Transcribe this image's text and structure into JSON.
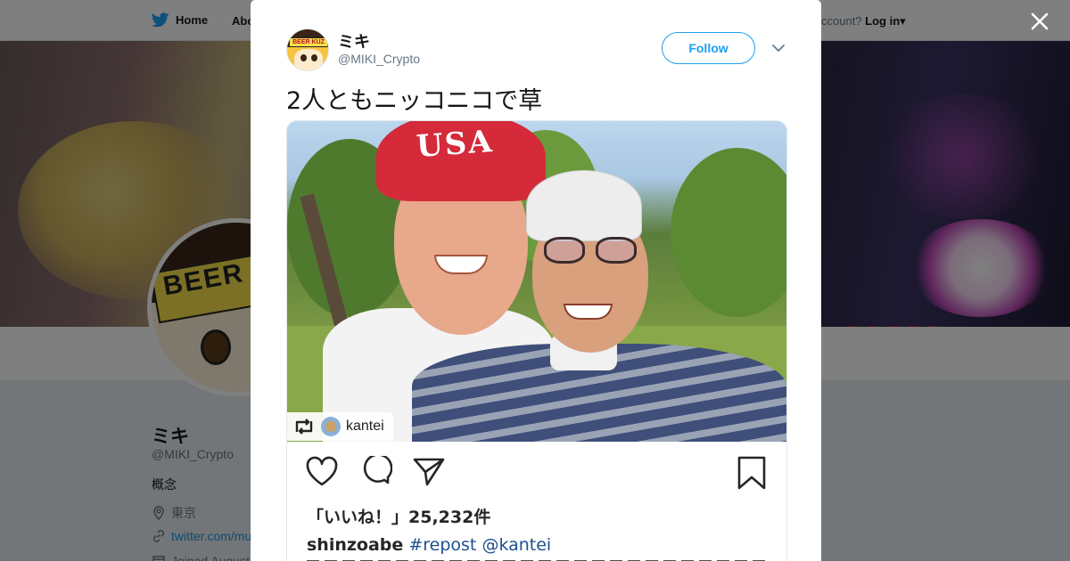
{
  "nav": {
    "home_label": "Home",
    "about_label": "Abo",
    "account_prompt": "ccount?",
    "login_label": "Log in"
  },
  "profile": {
    "name": "ミキ",
    "handle": "@MIKI_Crypto",
    "bio": "概念",
    "location": "東京",
    "url": "twitter.com/mu",
    "joined": "Joined August",
    "avatar_text": "BEER"
  },
  "tweet": {
    "author_name": "ミキ",
    "author_handle": "@MIKI_Crypto",
    "avatar_text": "BEER KUZ",
    "follow_label": "Follow",
    "text": "2人ともニッコニコで草",
    "media": {
      "cap_text": "USA",
      "repost_account": "kantei",
      "likes_text": "「いいね！」25,232件",
      "caption_user": "shinzoabe",
      "caption_hashtag": "#repost",
      "caption_mention": "@kantei"
    }
  },
  "colors": {
    "brand": "#1da1f2",
    "link": "#1b95e0",
    "text_primary": "#14171a",
    "text_secondary": "#657786"
  },
  "icons": [
    "twitter-bird-icon",
    "close-icon",
    "chevron-down-icon",
    "location-pin-icon",
    "link-icon",
    "calendar-icon",
    "repost-icon",
    "heart-icon",
    "comment-icon",
    "share-icon",
    "bookmark-icon"
  ]
}
